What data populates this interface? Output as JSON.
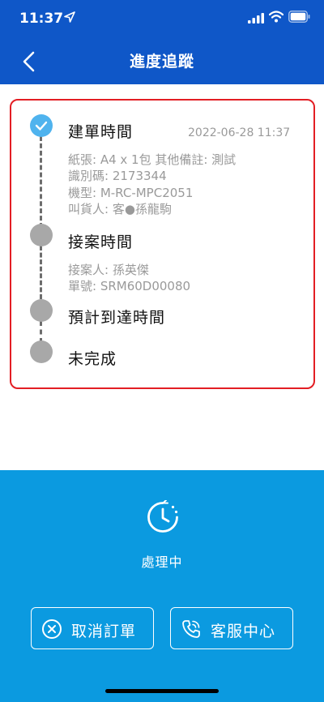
{
  "status_bar": {
    "time": "11:37"
  },
  "header": {
    "title": "進度追蹤"
  },
  "timeline": {
    "steps": [
      {
        "title": "建單時間",
        "date": "2022-06-28 11:37",
        "status": "done",
        "details": [
          "紙張: A4 x 1包 其他備註: 測試",
          "識別碼: 2173344",
          "機型: M-RC-MPC2051",
          "叫貨人: 客●孫龍駒"
        ]
      },
      {
        "title": "接案時間",
        "status": "pending",
        "details": [
          "接案人: 孫英傑",
          "單號: SRM60D00080"
        ]
      },
      {
        "title": "預計到達時間",
        "status": "pending"
      },
      {
        "title": "未完成",
        "status": "pending"
      }
    ]
  },
  "status_panel": {
    "state": "處理中"
  },
  "actions": {
    "cancel_label": "取消訂單",
    "service_label": "客服中心"
  },
  "colors": {
    "header": "#0f57c8",
    "panel": "#0b9ae0",
    "done_node": "#4fb3ee",
    "pending_node": "#a8a8a8",
    "highlight_border": "#e31e24"
  }
}
